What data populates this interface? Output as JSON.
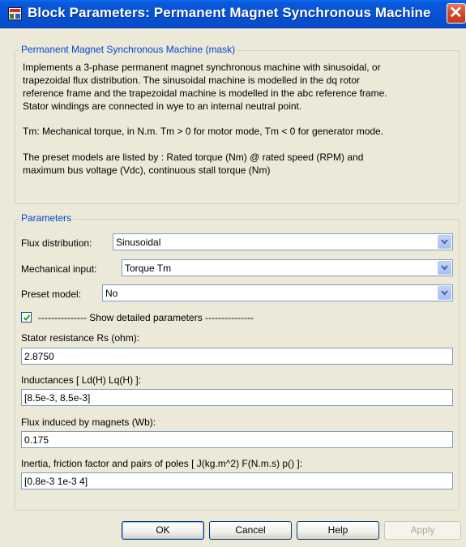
{
  "window": {
    "title": "Block Parameters: Permanent Magnet Synchronous Machine"
  },
  "mask_group": {
    "legend": "Permanent Magnet Synchronous Machine (mask)",
    "description_lines": [
      "Implements a 3-phase permanent magnet synchronous machine with sinusoidal, or",
      "trapezoidal flux distribution. The sinusoidal machine is modelled in the dq rotor",
      "reference frame and the trapezoidal machine is modelled in the abc reference frame.",
      "Stator windings are connected in wye to an internal neutral point.",
      "Tm:  Mechanical torque, in N.m. Tm > 0 for motor mode, Tm < 0 for generator mode.",
      "The preset models are listed by : Rated torque (Nm) @ rated speed (RPM) and",
      "maximum bus voltage (Vdc), continuous stall torque (Nm)"
    ]
  },
  "params_group": {
    "legend": "Parameters",
    "flux": {
      "label": "Flux distribution:",
      "value": "Sinusoidal"
    },
    "mech": {
      "label": "Mechanical input:",
      "value": "Torque Tm"
    },
    "preset": {
      "label": "Preset model:",
      "value": "No"
    },
    "show_detailed": {
      "label": "--------------- Show detailed parameters ---------------",
      "checked": true
    },
    "stator": {
      "label": "Stator resistance Rs (ohm):",
      "value": "2.8750"
    },
    "inductances": {
      "label": "Inductances [ Ld(H) Lq(H) ]:",
      "value": "[8.5e-3, 8.5e-3]"
    },
    "flux_magnets": {
      "label": "Flux induced by magnets (Wb):",
      "value": "0.175"
    },
    "inertia": {
      "label": "Inertia, friction factor and pairs of poles [ J(kg.m^2)  F(N.m.s)  p() ]:",
      "value": "[0.8e-3 1e-3 4]"
    }
  },
  "buttons": {
    "ok": "OK",
    "cancel": "Cancel",
    "help": "Help",
    "apply": "Apply"
  },
  "colors": {
    "titlebar": "#0655d6",
    "legend_text": "#0046d5",
    "dialog_bg": "#ece9d8",
    "close_button": "#d54a2a"
  },
  "icons": {
    "title": "simulink-block-icon",
    "close": "close-icon",
    "dropdown": "chevron-down-icon",
    "check": "checkmark-icon"
  }
}
